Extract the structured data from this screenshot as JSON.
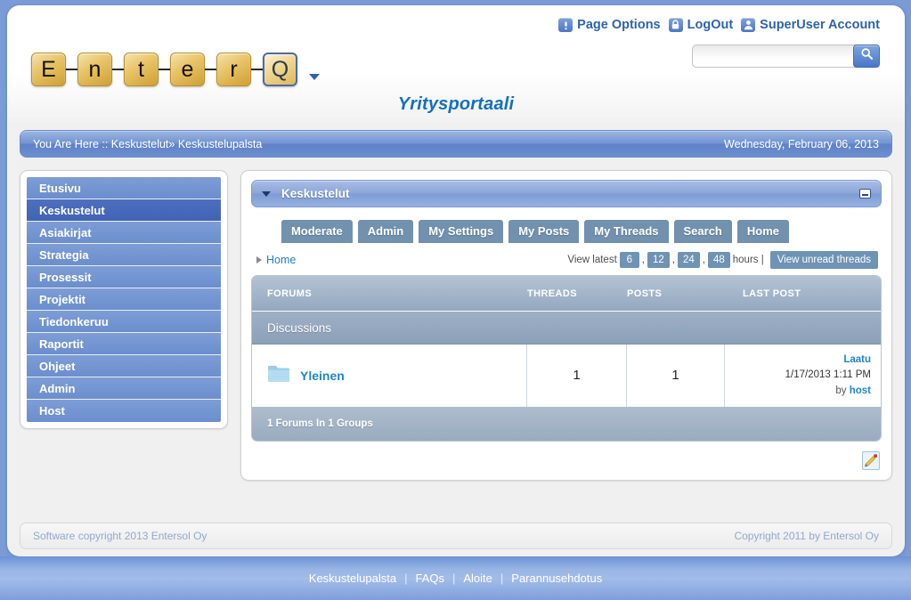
{
  "header": {
    "portal_title": "Yritysportaali",
    "logo_tiles": [
      "E",
      "n",
      "t",
      "e",
      "r",
      "Q"
    ],
    "logo_accent_index": 5,
    "utility_links": [
      {
        "label": "Page Options",
        "icon": "exclamation-icon"
      },
      {
        "label": "LogOut",
        "icon": "padlock-icon"
      },
      {
        "label": "SuperUser Account",
        "icon": "user-icon"
      }
    ],
    "search": {
      "value": "",
      "placeholder": "",
      "button_icon": "search-icon"
    }
  },
  "breadcrumb": {
    "text": "You Are Here :: Keskustelut» Keskustelupalsta",
    "date": "Wednesday, February 06, 2013"
  },
  "sidebar": {
    "items": [
      {
        "label": "Etusivu",
        "active": false
      },
      {
        "label": "Keskustelut",
        "active": true
      },
      {
        "label": "Asiakirjat",
        "active": false
      },
      {
        "label": "Strategia",
        "active": false
      },
      {
        "label": "Prosessit",
        "active": false
      },
      {
        "label": "Projektit",
        "active": false
      },
      {
        "label": "Tiedonkeruu",
        "active": false
      },
      {
        "label": "Raportit",
        "active": false
      },
      {
        "label": "Ohjeet",
        "active": false
      },
      {
        "label": "Admin",
        "active": false
      },
      {
        "label": "Host",
        "active": false
      }
    ]
  },
  "module": {
    "title": "Keskustelut",
    "caret_icon": "chevron-down-icon",
    "minimize_icon": "minimize-icon"
  },
  "forum": {
    "tabs": [
      "Moderate",
      "Admin",
      "My Settings",
      "My Posts",
      "My Threads",
      "Search",
      "Home"
    ],
    "breadcrumb_home": "Home",
    "view_latest_label": "View latest",
    "hours": [
      "6",
      "12",
      "24",
      "48"
    ],
    "hours_suffix": "hours |",
    "unread_button": "View unread threads",
    "columns": [
      "FORUMS",
      "THREADS",
      "POSTS",
      "LAST POST"
    ],
    "group_name": "Discussions",
    "rows": [
      {
        "name": "Yleinen",
        "icon": "folder-icon",
        "threads": "1",
        "posts": "1",
        "last_post_title": "Laatu",
        "last_post_date": "1/17/2013 1:11 PM",
        "last_post_by_prefix": "by",
        "last_post_author": "host"
      }
    ],
    "footer_summary": "1 Forums In 1 Groups",
    "edit_icon": "pencil-edit-icon"
  },
  "copyright": {
    "left": "Software copyright 2013 Entersol Oy",
    "right": "Copyright 2011 by Entersol Oy"
  },
  "footer_links": [
    "Keskustelupalsta",
    "FAQs",
    "Aloite",
    "Parannusehdotus"
  ],
  "colors": {
    "page_background": "#7b9bd6",
    "accent_blue": "#2d63b0",
    "link_blue": "#1e86cf",
    "title_blue": "#1270c0",
    "nav_blue": "#6b8ecd",
    "nav_active": "#4163b4",
    "tab_steel": "#7191ae",
    "table_header": "#93a8bf"
  }
}
